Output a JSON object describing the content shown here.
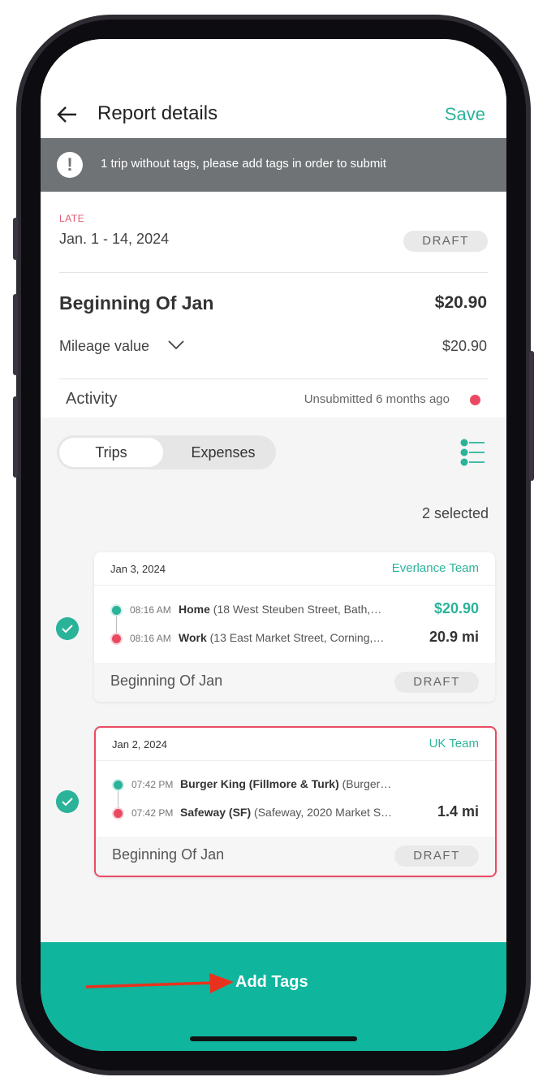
{
  "header": {
    "title": "Report details",
    "save_label": "Save"
  },
  "banner": {
    "icon": "exclamation-icon",
    "text": "1 trip without tags, please add tags in order to submit"
  },
  "report": {
    "status_label": "LATE",
    "period": "Jan. 1 - 14, 2024",
    "state": "DRAFT",
    "name": "Beginning Of Jan",
    "total": "$20.90",
    "mileage_label": "Mileage value",
    "mileage_value": "$20.90",
    "activity_label": "Activity",
    "activity_status": "Unsubmitted 6 months ago"
  },
  "tabs": {
    "trips": "Trips",
    "expenses": "Expenses"
  },
  "selection": {
    "count_text": "2 selected"
  },
  "trips": [
    {
      "date": "Jan 3, 2024",
      "team": "Everlance Team",
      "from_time": "08:16 AM",
      "from_name": "Home",
      "from_detail": " (18 West Steuben Street, Bath,…",
      "to_time": "08:16 AM",
      "to_name": "Work",
      "to_detail": " (13 East Market Street, Corning,…",
      "amount": "$20.90",
      "distance": "20.9 mi",
      "report": "Beginning Of Jan",
      "state": "DRAFT"
    },
    {
      "date": "Jan 2, 2024",
      "team": "UK Team",
      "from_time": "07:42 PM",
      "from_name": "Burger King (Fillmore & Turk)",
      "from_detail": " (Burger…",
      "to_time": "07:42 PM",
      "to_name": "Safeway (SF)",
      "to_detail": " (Safeway, 2020 Market S…",
      "distance": "1.4 mi",
      "report": "Beginning Of Jan",
      "state": "DRAFT"
    }
  ],
  "action": {
    "label": "Add Tags"
  },
  "colors": {
    "accent": "#2bb39a",
    "action_bar": "#0fb59d",
    "alert": "#e94a62",
    "banner": "#6f7376"
  }
}
